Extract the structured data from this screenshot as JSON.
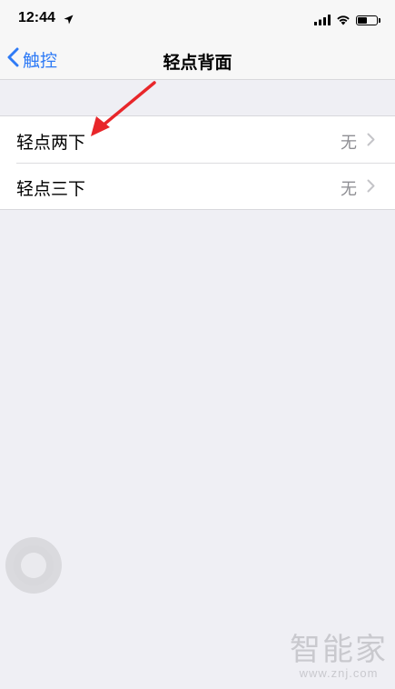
{
  "status_bar": {
    "time": "12:44",
    "location_icon": "location-arrow-icon",
    "signal_icon": "cellular-signal-icon",
    "wifi_icon": "wifi-icon",
    "battery_icon": "battery-icon",
    "battery_level": 0.55
  },
  "nav": {
    "back_label": "触控",
    "back_icon": "chevron-left-icon",
    "title": "轻点背面"
  },
  "rows": [
    {
      "label": "轻点两下",
      "value": "无",
      "icon": "chevron-right-icon"
    },
    {
      "label": "轻点三下",
      "value": "无",
      "icon": "chevron-right-icon"
    }
  ],
  "annotation": {
    "icon": "red-arrow-icon",
    "color": "#e8262a"
  },
  "assistive_touch": {
    "icon": "assistive-touch-icon"
  },
  "watermark": {
    "logo_text": "智能家",
    "url": "www.znj.com"
  },
  "colors": {
    "accent": "#2f7bf6",
    "background": "#efeff4",
    "secondary_text": "#8e8e93"
  }
}
